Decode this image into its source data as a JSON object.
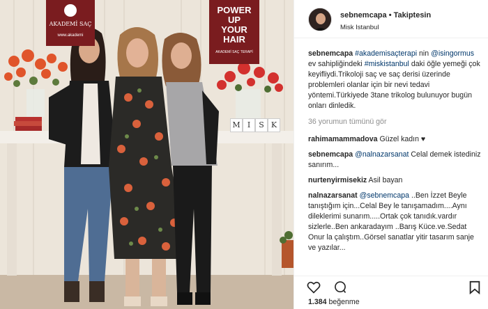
{
  "photo": {
    "sign_left_text": "AKADEMİ SAÇ",
    "sign_left_small": "www.akademi",
    "sign_right_lines": [
      "POWER",
      "UP",
      "YOUR",
      "HAIR"
    ],
    "sign_right_small": "AKADEMİ SAÇ TERAPİ",
    "table_letters": [
      "M",
      "I",
      "S",
      "K"
    ]
  },
  "header": {
    "username": "sebnemcapa",
    "separator": " • ",
    "follow": "Takiptesin",
    "location": "Misk Istanbul"
  },
  "caption": {
    "username": "sebnemcapa",
    "tag1": "#akademisaçterapi",
    "t1": " nin ",
    "tag2": "@isingormus",
    "t2": " ev sahipliğindeki ",
    "tag3": "#miskistanbul",
    "t3": " daki öğle yemeği çok keyifliydi.Trikoloji saç ve saç derisi üzerinde problemleri olanlar için bir nevi tedavi yöntemi.Türkiyede 3tane trikolog bulunuyor bugün onları dinledik."
  },
  "view_all": "36 yorumun tümünü gör",
  "comments": [
    {
      "user": "rahimamammadova",
      "text": " Güzel kadın ♥"
    },
    {
      "user": "sebnemcapa",
      "mention": "@nalnazarsanat",
      "text": " Celal demek istediniz sanırım..."
    },
    {
      "user": "nurtenyirmisekiz",
      "text": " Asil bayan"
    },
    {
      "user": "nalnazarsanat",
      "mention": "@sebnemcapa",
      "text": " ..Ben İzzet Beyle tanıştığım için...Celal Bey le tanışamadım....Aynı dileklerimi sunarım.....Ortak çok tanıdık.vardır sizlerle..Ben ankaradayım ..Barış Küce.ve.Sedat Onur la çalıştım..Görsel sanatlar yitir tasarım sanje ve yazılar..."
    }
  ],
  "likes": {
    "count": "1.384",
    "label": " beğenme"
  },
  "icons": [
    "heart-icon",
    "comment-icon",
    "bookmark-icon"
  ]
}
